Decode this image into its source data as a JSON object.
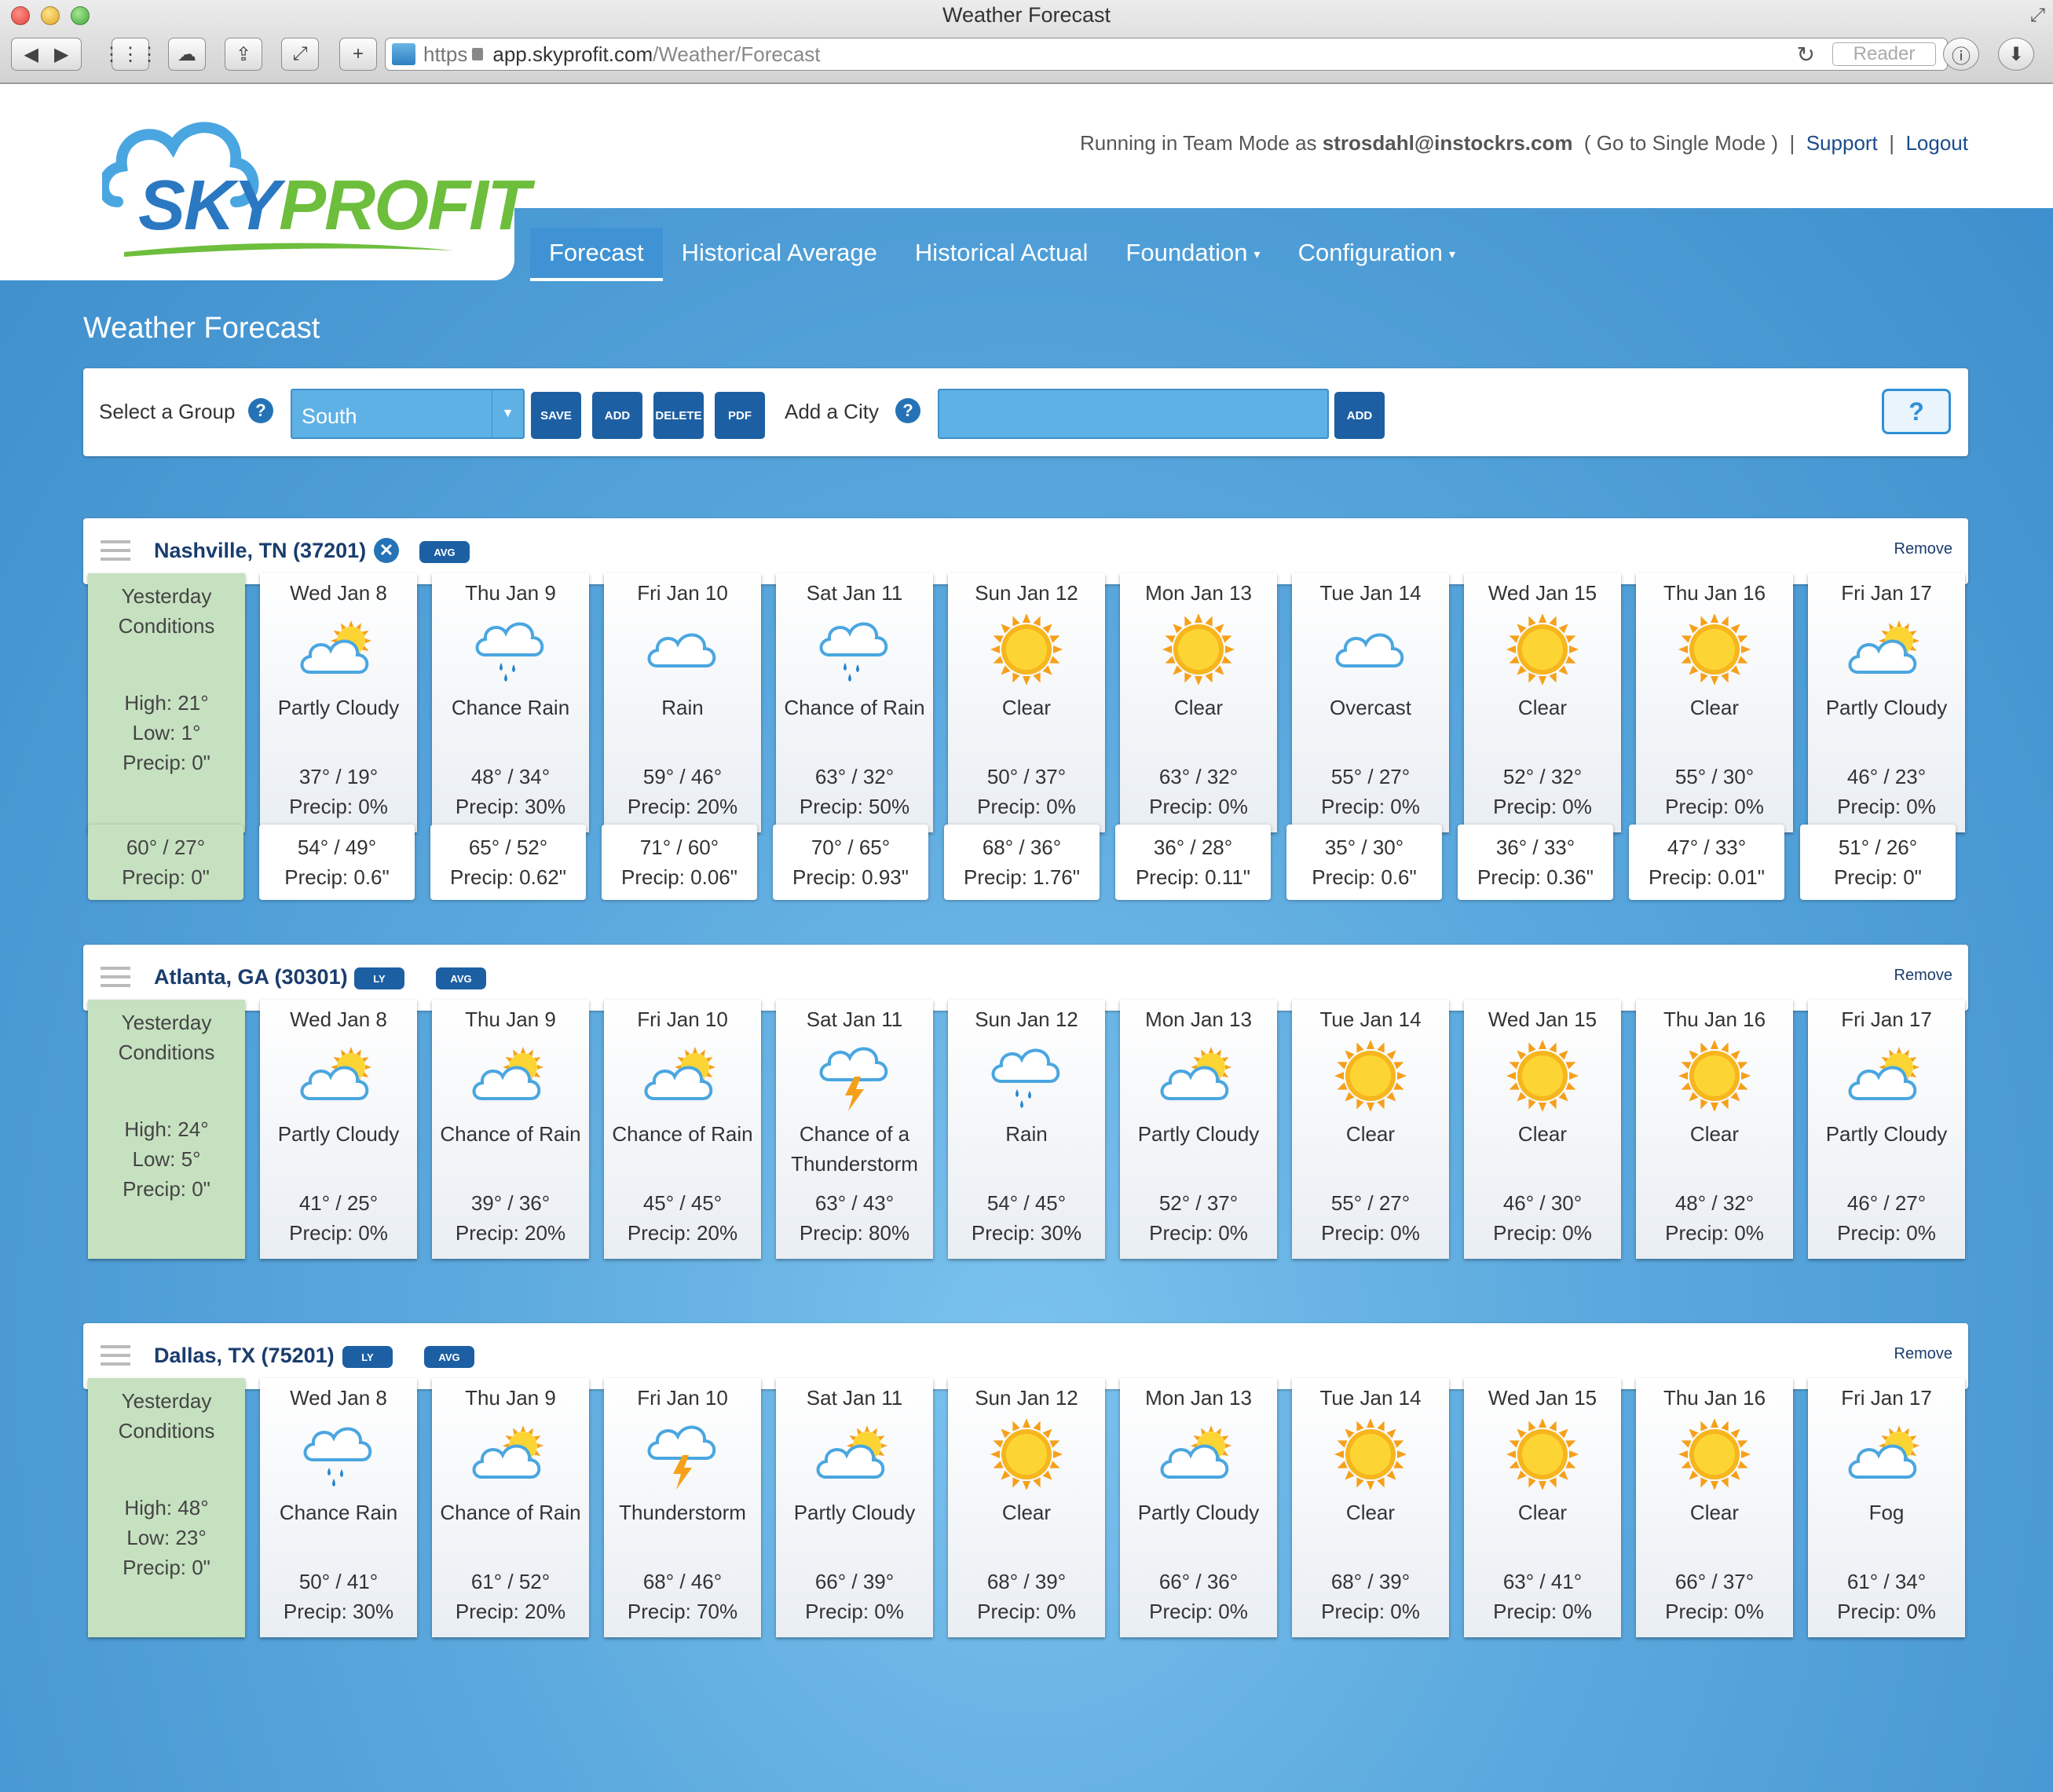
{
  "browser": {
    "title": "Weather Forecast",
    "scheme": "https",
    "host": "app.skyprofit.com",
    "path": "/Weather/Forecast",
    "reader": "Reader"
  },
  "logo": {
    "sky": "SKY",
    "profit": "PROFIT"
  },
  "userbar": {
    "prefix": "Running in Team Mode as ",
    "email": "strosdahl@instockrs.com",
    "mode_link": "( Go to Single Mode )",
    "sep1": "|",
    "support": "Support",
    "sep2": "|",
    "logout": "Logout"
  },
  "nav": [
    {
      "label": "Forecast"
    },
    {
      "label": "Historical Average"
    },
    {
      "label": "Historical Actual"
    },
    {
      "label": "Foundation",
      "caret": "▾"
    },
    {
      "label": "Configuration",
      "caret": "▾"
    }
  ],
  "page_title": "Weather Forecast",
  "groupbar": {
    "select_label": "Select a Group",
    "help": "?",
    "group_value": "South",
    "save": "SAVE",
    "add": "ADD",
    "delete": "DELETE",
    "pdf": "PDF",
    "add_city_label": "Add a City",
    "city_value": "",
    "city_add": "ADD",
    "legend": "?"
  },
  "labels": {
    "ly": "LY",
    "avg": "AVG",
    "remove": "Remove",
    "x": "✕"
  },
  "cities": [
    {
      "name": "Nashville, TN (37201)",
      "yesterday": {
        "title": "Yesterday Conditions",
        "high": "High: 21°",
        "low": "Low: 1°",
        "precip": "Precip: 0\""
      },
      "days": [
        {
          "day": "Wed Jan 8",
          "icon": "partly-cloudy-icon",
          "cond": "Partly Cloudy",
          "temp": "37° / 19°",
          "precip": "Precip: 0%"
        },
        {
          "day": "Thu Jan 9",
          "icon": "rain-icon",
          "cond": "Chance Rain",
          "temp": "48° / 34°",
          "precip": "Precip: 30%"
        },
        {
          "day": "Fri Jan 10",
          "icon": "cloud-icon",
          "cond": "Rain",
          "temp": "59° / 46°",
          "precip": "Precip: 20%"
        },
        {
          "day": "Sat Jan 11",
          "icon": "rain-icon",
          "cond": "Chance of Rain",
          "temp": "63° / 32°",
          "precip": "Precip: 50%"
        },
        {
          "day": "Sun Jan 12",
          "icon": "sun-icon",
          "cond": "Clear",
          "temp": "50° / 37°",
          "precip": "Precip: 0%"
        },
        {
          "day": "Mon Jan 13",
          "icon": "sun-icon",
          "cond": "Clear",
          "temp": "63° / 32°",
          "precip": "Precip: 0%"
        },
        {
          "day": "Tue Jan 14",
          "icon": "cloud-icon",
          "cond": "Overcast",
          "temp": "55° / 27°",
          "precip": "Precip: 0%"
        },
        {
          "day": "Wed Jan 15",
          "icon": "sun-icon",
          "cond": "Clear",
          "temp": "52° / 32°",
          "precip": "Precip: 0%"
        },
        {
          "day": "Thu Jan 16",
          "icon": "sun-icon",
          "cond": "Clear",
          "temp": "55° / 30°",
          "precip": "Precip: 0%"
        },
        {
          "day": "Fri Jan 17",
          "icon": "partly-cloudy-icon",
          "cond": "Partly Cloudy",
          "temp": "46° / 23°",
          "precip": "Precip: 0%"
        }
      ],
      "history": [
        {
          "temp": "60° / 27°",
          "precip": "Precip: 0\""
        },
        {
          "temp": "54° / 49°",
          "precip": "Precip: 0.6\""
        },
        {
          "temp": "65° / 52°",
          "precip": "Precip: 0.62\""
        },
        {
          "temp": "71° / 60°",
          "precip": "Precip: 0.06\""
        },
        {
          "temp": "70° / 65°",
          "precip": "Precip: 0.93\""
        },
        {
          "temp": "68° / 36°",
          "precip": "Precip: 1.76\""
        },
        {
          "temp": "36° / 28°",
          "precip": "Precip: 0.11\""
        },
        {
          "temp": "35° / 30°",
          "precip": "Precip: 0.6\""
        },
        {
          "temp": "36° / 33°",
          "precip": "Precip: 0.36\""
        },
        {
          "temp": "47° / 33°",
          "precip": "Precip: 0.01\""
        },
        {
          "temp": "51° / 26°",
          "precip": "Precip: 0\""
        }
      ]
    },
    {
      "name": "Atlanta, GA (30301)",
      "yesterday": {
        "title": "Yesterday Conditions",
        "high": "High: 24°",
        "low": "Low: 5°",
        "precip": "Precip: 0\""
      },
      "days": [
        {
          "day": "Wed Jan 8",
          "icon": "partly-cloudy-icon",
          "cond": "Partly Cloudy",
          "temp": "41° / 25°",
          "precip": "Precip: 0%"
        },
        {
          "day": "Thu Jan 9",
          "icon": "partly-cloudy-icon",
          "cond": "Chance of Rain",
          "temp": "39° / 36°",
          "precip": "Precip: 20%"
        },
        {
          "day": "Fri Jan 10",
          "icon": "partly-cloudy-icon",
          "cond": "Chance of Rain",
          "temp": "45° / 45°",
          "precip": "Precip: 20%"
        },
        {
          "day": "Sat Jan 11",
          "icon": "thunderstorm-icon",
          "cond": "Chance of a Thunderstorm",
          "temp": "63° / 43°",
          "precip": "Precip: 80%"
        },
        {
          "day": "Sun Jan 12",
          "icon": "rain-icon",
          "cond": "Rain",
          "temp": "54° / 45°",
          "precip": "Precip: 30%"
        },
        {
          "day": "Mon Jan 13",
          "icon": "partly-cloudy-icon",
          "cond": "Partly Cloudy",
          "temp": "52° / 37°",
          "precip": "Precip: 0%"
        },
        {
          "day": "Tue Jan 14",
          "icon": "sun-icon",
          "cond": "Clear",
          "temp": "55° / 27°",
          "precip": "Precip: 0%"
        },
        {
          "day": "Wed Jan 15",
          "icon": "sun-icon",
          "cond": "Clear",
          "temp": "46° / 30°",
          "precip": "Precip: 0%"
        },
        {
          "day": "Thu Jan 16",
          "icon": "sun-icon",
          "cond": "Clear",
          "temp": "48° / 32°",
          "precip": "Precip: 0%"
        },
        {
          "day": "Fri Jan 17",
          "icon": "partly-cloudy-icon",
          "cond": "Partly Cloudy",
          "temp": "46° / 27°",
          "precip": "Precip: 0%"
        }
      ]
    },
    {
      "name": "Dallas, TX (75201)",
      "yesterday": {
        "title": "Yesterday Conditions",
        "high": "High: 48°",
        "low": "Low: 23°",
        "precip": "Precip: 0\""
      },
      "days": [
        {
          "day": "Wed Jan 8",
          "icon": "rain-icon",
          "cond": "Chance Rain",
          "temp": "50° / 41°",
          "precip": "Precip: 30%"
        },
        {
          "day": "Thu Jan 9",
          "icon": "partly-cloudy-icon",
          "cond": "Chance of Rain",
          "temp": "61° / 52°",
          "precip": "Precip: 20%"
        },
        {
          "day": "Fri Jan 10",
          "icon": "thunderstorm-icon",
          "cond": "Thunderstorm",
          "temp": "68° / 46°",
          "precip": "Precip: 70%"
        },
        {
          "day": "Sat Jan 11",
          "icon": "partly-cloudy-icon",
          "cond": "Partly Cloudy",
          "temp": "66° / 39°",
          "precip": "Precip: 0%"
        },
        {
          "day": "Sun Jan 12",
          "icon": "sun-icon",
          "cond": "Clear",
          "temp": "68° / 39°",
          "precip": "Precip: 0%"
        },
        {
          "day": "Mon Jan 13",
          "icon": "partly-cloudy-icon",
          "cond": "Partly Cloudy",
          "temp": "66° / 36°",
          "precip": "Precip: 0%"
        },
        {
          "day": "Tue Jan 14",
          "icon": "sun-icon",
          "cond": "Clear",
          "temp": "68° / 39°",
          "precip": "Precip: 0%"
        },
        {
          "day": "Wed Jan 15",
          "icon": "sun-icon",
          "cond": "Clear",
          "temp": "63° / 41°",
          "precip": "Precip: 0%"
        },
        {
          "day": "Thu Jan 16",
          "icon": "sun-icon",
          "cond": "Clear",
          "temp": "66° / 37°",
          "precip": "Precip: 0%"
        },
        {
          "day": "Fri Jan 17",
          "icon": "partly-cloudy-icon",
          "cond": "Fog",
          "temp": "61° / 34°",
          "precip": "Precip: 0%"
        }
      ]
    }
  ],
  "colors": {
    "accent": "#1d5fa3",
    "page_bg": "#5aa6db",
    "yesterday_bg": "#c6e1c0",
    "logo_blue": "#2b78c2",
    "logo_green": "#6dbe3c"
  }
}
